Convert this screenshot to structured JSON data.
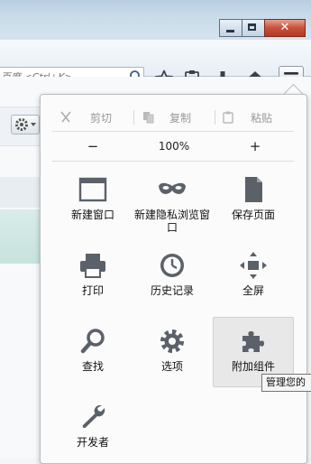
{
  "search": {
    "placeholder": "百度 <Ctrl+K>"
  },
  "panel": {
    "edit": {
      "cut": "剪切",
      "copy": "复制",
      "paste": "粘贴"
    },
    "zoom": {
      "out": "−",
      "level": "100%",
      "in": "+"
    },
    "items": [
      {
        "label": "新建窗口",
        "icon": "new-window-icon"
      },
      {
        "label": "新建隐私浏览窗口",
        "icon": "private-mask-icon"
      },
      {
        "label": "保存页面",
        "icon": "save-page-icon"
      },
      {
        "label": "打印",
        "icon": "print-icon"
      },
      {
        "label": "历史记录",
        "icon": "history-icon"
      },
      {
        "label": "全屏",
        "icon": "fullscreen-icon"
      },
      {
        "label": "查找",
        "icon": "find-icon"
      },
      {
        "label": "选项",
        "icon": "options-gear-icon"
      },
      {
        "label": "附加组件",
        "icon": "addons-puzzle-icon"
      },
      {
        "label": "开发者",
        "icon": "developer-wrench-icon"
      }
    ]
  },
  "tooltip": {
    "text": "管理您的"
  },
  "colors": {
    "icon_gray": "#5b6169",
    "close_red": "#c9503a"
  }
}
